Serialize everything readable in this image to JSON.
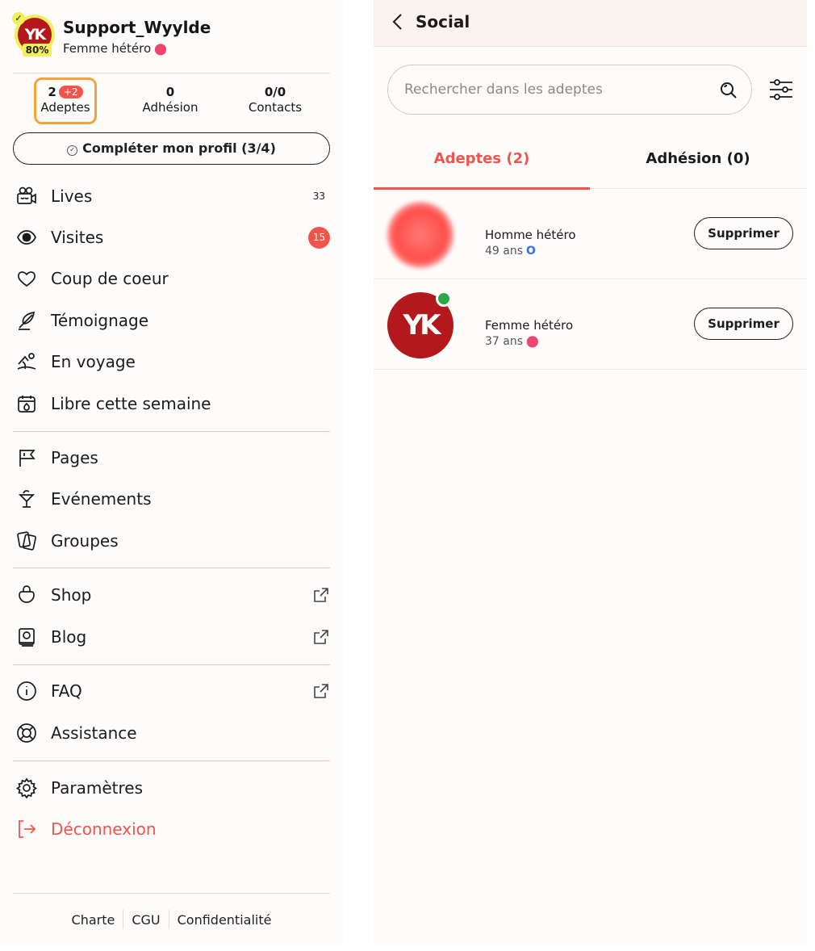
{
  "profile": {
    "username": "Support_Wyylde",
    "orientation": "Femme hétéro",
    "completion": "80%",
    "avatar_text": "YK"
  },
  "stats": {
    "adeptes": {
      "value": "2",
      "badge": "+2",
      "label": "Adeptes"
    },
    "adhesion": {
      "value": "0",
      "label": "Adhésion"
    },
    "contacts": {
      "value": "0/0",
      "label": "Contacts"
    }
  },
  "complete_profile_label": "Compléter mon profil (3/4)",
  "menu": {
    "lives": {
      "label": "Lives",
      "count": "33",
      "icon": "video-camera-icon"
    },
    "visites": {
      "label": "Visites",
      "count": "15",
      "icon": "eye-icon"
    },
    "coup": {
      "label": "Coup de coeur",
      "icon": "heart-icon"
    },
    "temoignage": {
      "label": "Témoignage",
      "icon": "feather-icon"
    },
    "voyage": {
      "label": "En voyage",
      "icon": "travel-icon"
    },
    "libre": {
      "label": "Libre cette semaine",
      "icon": "calendar-icon"
    },
    "pages": {
      "label": "Pages",
      "icon": "flag-icon"
    },
    "evenements": {
      "label": "Evénements",
      "icon": "cocktail-icon"
    },
    "groupes": {
      "label": "Groupes",
      "icon": "cards-icon"
    },
    "shop": {
      "label": "Shop",
      "icon": "shopping-bag-icon"
    },
    "blog": {
      "label": "Blog",
      "icon": "book-icon"
    },
    "faq": {
      "label": "FAQ",
      "icon": "info-icon"
    },
    "assistance": {
      "label": "Assistance",
      "icon": "lifebuoy-icon"
    },
    "parametres": {
      "label": "Paramètres",
      "icon": "gear-icon"
    },
    "deconnexion": {
      "label": "Déconnexion",
      "icon": "logout-icon"
    }
  },
  "footer": {
    "charte": "Charte",
    "cgu": "CGU",
    "confidentialite": "Confidentialité"
  },
  "social": {
    "title": "Social",
    "search_placeholder": "Rechercher dans les adeptes",
    "tabs": {
      "adeptes": "Adeptes (2)",
      "adhesion": "Adhésion (0)"
    },
    "rows": [
      {
        "title": "Homme hétéro",
        "age": "49 ans",
        "button": "Supprimer"
      },
      {
        "title": "Femme hétéro",
        "age": "37 ans",
        "button": "Supprimer",
        "avatar_text": "YK"
      }
    ]
  },
  "colors": {
    "accent": "#f0544a",
    "highlight": "#f6a23a",
    "brand": "#b3181d",
    "online": "#2aa84a",
    "completion": "#f2ef5a"
  }
}
